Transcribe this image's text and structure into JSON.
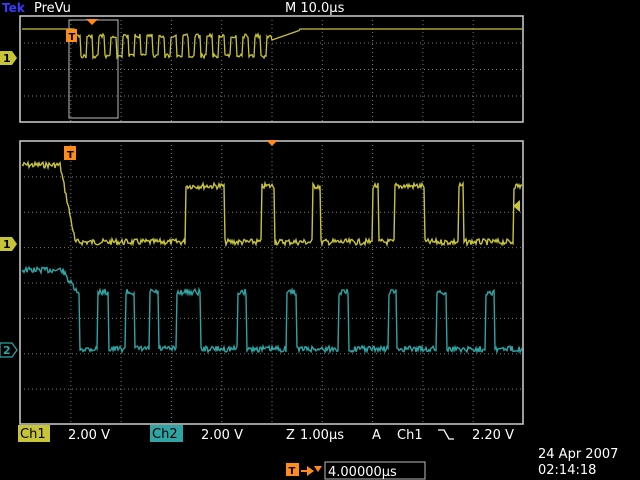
{
  "header": {
    "brand": "Tek",
    "mode": "PreVu",
    "timebase": "M 10.0µs"
  },
  "markers": {
    "trigger_label": "T",
    "ch1_label": "1",
    "ch2_label": "2"
  },
  "statusbar": {
    "ch1_name": "Ch1",
    "ch1_scale": "2.00 V",
    "ch2_name": "Ch2",
    "ch2_scale": "2.00 V",
    "zoom_name": "Z",
    "zoom_scale": "1.00µs",
    "acq_name": "A",
    "trig_source": "Ch1",
    "trig_slope_icon": "falling-edge-icon",
    "trig_level": "2.20 V"
  },
  "footer": {
    "trigger_position": "4.00000µs",
    "date": "24 Apr 2007",
    "time": "02:14:18"
  },
  "colors": {
    "ch1": "#c8c43a",
    "ch2": "#2fa4a4",
    "trigger": "#ff8c1a",
    "grid": "#7a7a7a",
    "brand": "#2a2acc",
    "label_bg": "#c8c43a"
  }
}
